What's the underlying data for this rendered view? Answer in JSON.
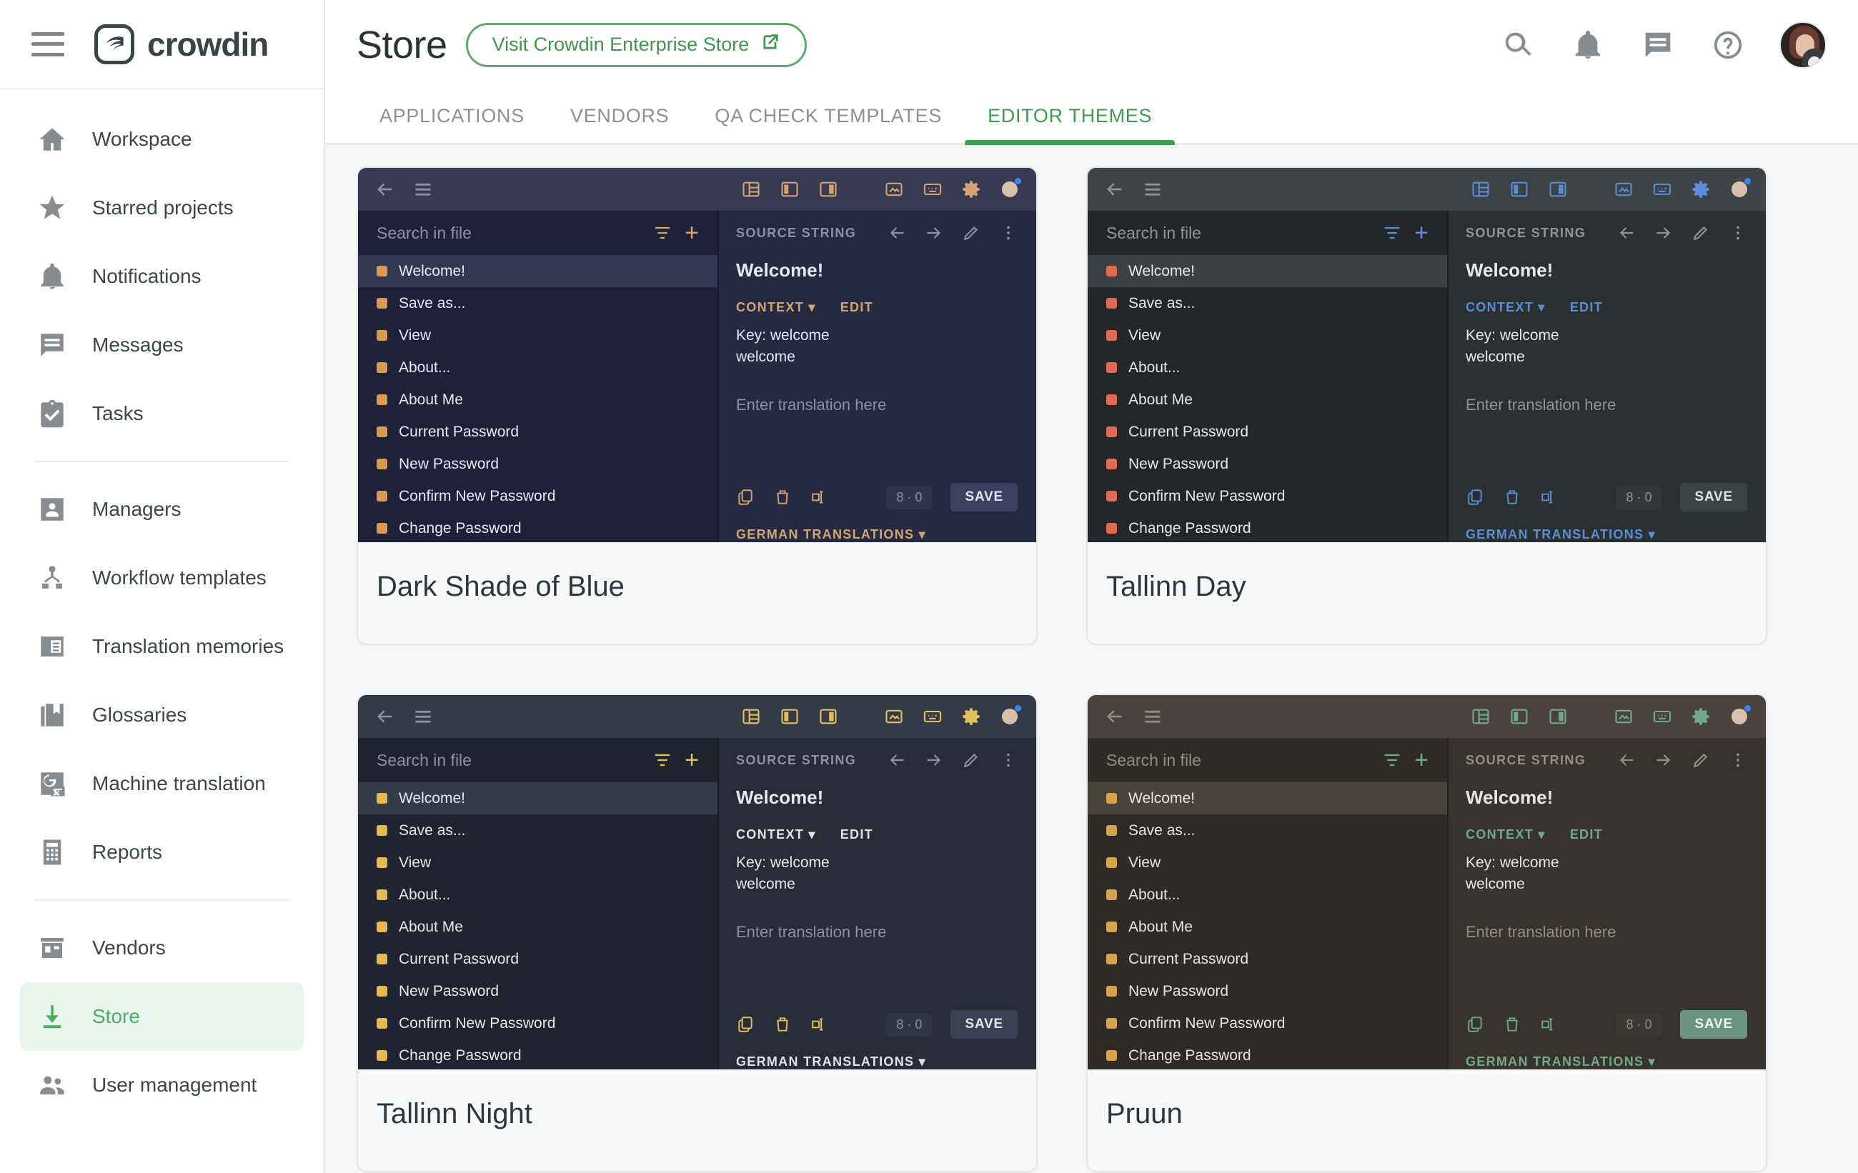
{
  "brand": {
    "name": "crowdin",
    "logo_icon": "crowdin-logo-icon",
    "menu_icon": "hamburger-menu-icon"
  },
  "header": {
    "title": "Store",
    "enterprise_button": {
      "label": "Visit Crowdin Enterprise Store",
      "icon": "external-link-icon"
    },
    "icons": [
      {
        "name": "search-icon",
        "glyph": "search"
      },
      {
        "name": "notifications-bell-icon",
        "glyph": "bell"
      },
      {
        "name": "messages-icon",
        "glyph": "message"
      },
      {
        "name": "help-icon",
        "glyph": "help"
      }
    ],
    "avatar": {
      "name": "user-avatar"
    }
  },
  "tabs": [
    {
      "label": "APPLICATIONS",
      "active": false
    },
    {
      "label": "VENDORS",
      "active": false
    },
    {
      "label": "QA CHECK TEMPLATES",
      "active": false
    },
    {
      "label": "EDITOR THEMES",
      "active": true
    }
  ],
  "sidebar": {
    "items": [
      {
        "label": "Workspace",
        "icon": "home-icon",
        "active": false
      },
      {
        "label": "Starred projects",
        "icon": "star-icon",
        "active": false
      },
      {
        "label": "Notifications",
        "icon": "bell-icon",
        "active": false
      },
      {
        "label": "Messages",
        "icon": "message-icon",
        "active": false
      },
      {
        "label": "Tasks",
        "icon": "tasks-clipboard-icon",
        "active": false
      }
    ],
    "items2": [
      {
        "label": "Managers",
        "icon": "manager-person-icon",
        "active": false
      },
      {
        "label": "Workflow templates",
        "icon": "workflow-icon",
        "active": false
      },
      {
        "label": "Translation memories",
        "icon": "translation-memory-icon",
        "active": false
      },
      {
        "label": "Glossaries",
        "icon": "glossary-book-icon",
        "active": false
      },
      {
        "label": "Machine translation",
        "icon": "machine-translation-icon",
        "active": false
      },
      {
        "label": "Reports",
        "icon": "reports-calculator-icon",
        "active": false
      }
    ],
    "items3": [
      {
        "label": "Vendors",
        "icon": "vendors-store-icon",
        "active": false
      },
      {
        "label": "Store",
        "icon": "store-download-icon",
        "active": true
      },
      {
        "label": "User management",
        "icon": "user-management-icon",
        "active": false
      }
    ]
  },
  "colors": {
    "accent_green": "#43a04f",
    "sidebar_active_bg": "#e9f5ec",
    "content_bg": "#f5f6f8",
    "card_bg": "#f7f8fa",
    "card_border": "#e4e6e9"
  },
  "editor_preview_strings": {
    "search_placeholder": "Search in file",
    "filter_icon": "filter-icon",
    "add_icon": "plus-icon",
    "back_icon": "back-arrow-icon",
    "menu_icon": "hamburger-menu-icon",
    "list": [
      "Welcome!",
      "Save as...",
      "View",
      "About...",
      "About Me",
      "Current Password",
      "New Password",
      "Confirm New Password",
      "Change Password"
    ],
    "source_string_label": "SOURCE STRING",
    "source_value": "Welcome!",
    "context_label": "CONTEXT",
    "edit_label": "EDIT",
    "key_line1": "Key: welcome",
    "key_line2": "welcome",
    "translation_placeholder": "Enter translation here",
    "counter": "8 · 0",
    "save_label": "SAVE",
    "german_label": "GERMAN TRANSLATIONS"
  },
  "themes": [
    {
      "title": "Dark Shade of Blue",
      "palette": {
        "topbar": "#373a52",
        "sidebar": "#1f2236",
        "panel": "#262a40",
        "row_active": "#343855",
        "text": "#e7e8ef",
        "muted": "#8d90a8",
        "accent": "#d4a373",
        "badge": "#d99a52",
        "save_bg": "#3c4161",
        "save_text": "#e3e5f0",
        "count_bg": "#30344c",
        "divider": "#161828",
        "ctx_color": "#d4a373",
        "scroll": "#4a4f70"
      }
    },
    {
      "title": "Tallinn Day",
      "palette": {
        "topbar": "#3d4346",
        "sidebar": "#232729",
        "panel": "#2b3032",
        "row_active": "#3a4043",
        "text": "#e6e8e8",
        "muted": "#8f9597",
        "accent": "#5b8dd6",
        "badge": "#e06a55",
        "save_bg": "#3c4346",
        "save_text": "#e2e5e6",
        "count_bg": "#333839",
        "divider": "#191c1d",
        "ctx_color": "#5b8dd6",
        "scroll": "#4e5558"
      }
    },
    {
      "title": "Tallinn Night",
      "palette": {
        "topbar": "#343a47",
        "sidebar": "#20242e",
        "panel": "#272c37",
        "row_active": "#353b49",
        "text": "#e6e8ee",
        "muted": "#8d939e",
        "accent": "#e3c05e",
        "badge": "#e6b84f",
        "save_bg": "#3a4150",
        "save_text": "#e3e6ec",
        "count_bg": "#2f3542",
        "divider": "#171a22",
        "ctx_color": "#dfe2e8",
        "scroll": "#4a5161"
      }
    },
    {
      "title": "Pruun",
      "palette": {
        "topbar": "#4a423e",
        "sidebar": "#2e2a26",
        "panel": "#38332e",
        "row_active": "#4a433c",
        "text": "#e9e4dd",
        "muted": "#958d83",
        "accent": "#6fa98a",
        "badge": "#d8a24e",
        "save_bg": "#6a9480",
        "save_text": "#f2f4f1",
        "count_bg": "#3d3833",
        "divider": "#211e1b",
        "ctx_color": "#6fa98a",
        "scroll": "#5a5249"
      }
    }
  ]
}
